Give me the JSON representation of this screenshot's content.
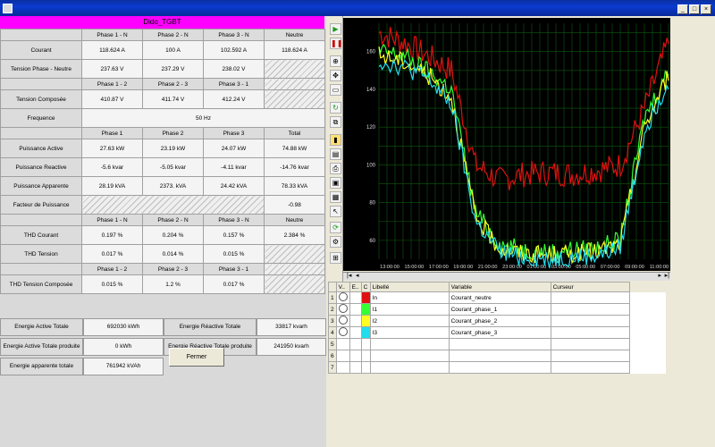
{
  "window": {
    "title_buttons": [
      "_",
      "□",
      "×"
    ]
  },
  "banner": "Dido_TGBT",
  "table": {
    "rows": [
      {
        "type": "hdr",
        "cells": [
          "Phase 1 - N",
          "Phase 2 - N",
          "Phase 3 - N",
          "Neutre"
        ]
      },
      {
        "type": "data",
        "label": "Courant",
        "cells": [
          "118.624 A",
          "100 A",
          "102.592 A",
          "118.624 A"
        ]
      },
      {
        "type": "data",
        "label": "Tension Phase - Neutre",
        "cells": [
          "237.63 V",
          "237.29 V",
          "238.02 V"
        ]
      },
      {
        "type": "hdr",
        "cells": [
          "Phase 1 - 2",
          "Phase 2 - 3",
          "Phase 3 - 1"
        ]
      },
      {
        "type": "data",
        "label": "Tension Composée",
        "cells": [
          "410.87 V",
          "411.74 V",
          "412.24 V"
        ]
      },
      {
        "type": "data",
        "label": "Frequence",
        "span": "50 Hz"
      },
      {
        "type": "hdr",
        "cells": [
          "Phase 1",
          "Phase 2",
          "Phase 3",
          "Total"
        ]
      },
      {
        "type": "data",
        "label": "Puissance Active",
        "cells": [
          "27.63 kW",
          "23.19 kW",
          "24.07 kW",
          "74.88 kW"
        ]
      },
      {
        "type": "data",
        "label": "Puissance Reactive",
        "cells": [
          "-5.6 kvar",
          "-5.05 kvar",
          "-4.11 kvar",
          "-14.76 kvar"
        ]
      },
      {
        "type": "data",
        "label": "Puissance Apparente",
        "cells": [
          "28.19 kVA",
          "2373. kVA",
          "24.42 kVA",
          "78.33 kVA"
        ]
      },
      {
        "type": "data",
        "label": "Facteur de Puissance",
        "hatched3": true,
        "cells": [
          "-0.98"
        ]
      },
      {
        "type": "hdr",
        "cells": [
          "Phase 1 - N",
          "Phase 2 - N",
          "Phase 3 - N",
          "Neutre"
        ]
      },
      {
        "type": "data",
        "label": "THD Courant",
        "cells": [
          "0.197 %",
          "0.204 %",
          "0.157 %",
          "2.384 %"
        ]
      },
      {
        "type": "data",
        "label": "THD Tension",
        "cells": [
          "0.017 %",
          "0.014 %",
          "0.015 %"
        ]
      },
      {
        "type": "hdr",
        "cells": [
          "Phase 1 - 2",
          "Phase 2 - 3",
          "Phase 3 - 1"
        ]
      },
      {
        "type": "data",
        "label": "THD Tension Composée",
        "cells": [
          "0.015 %",
          "1.2 %",
          "0.017 %"
        ]
      }
    ]
  },
  "energy": [
    {
      "label": "Energie Active Totale consommée",
      "value": "692030 kWh"
    },
    {
      "label": "Energie Réactive Totale consommée",
      "value": "33817 kvarh"
    },
    {
      "label": "Energie Active Totale produite",
      "value": "0 kWh"
    },
    {
      "label": "Energie Réactive Totale produite",
      "value": "241950 kvarh"
    },
    {
      "label": "Energie apparente totale",
      "value": "761942 kVAh"
    }
  ],
  "fermer_label": "Fermer",
  "chart_data": {
    "type": "line",
    "x": [
      "13:00:00",
      "15:00:00",
      "17:00:00",
      "19:00:00",
      "21:00:00",
      "23:00:00",
      "01:00:00",
      "03:00:00",
      "05:00:00",
      "07:00:00",
      "09:00:00",
      "11:00:00"
    ],
    "yticks": [
      60,
      80,
      100,
      120,
      140,
      160
    ],
    "ylim": [
      50,
      175
    ],
    "series": [
      {
        "name": "In",
        "color": "#e01010",
        "values": [
          170,
          165,
          158,
          150,
          100,
          92,
          95,
          96,
          95,
          97,
          100,
          130,
          165
        ]
      },
      {
        "name": "I1",
        "color": "#33ff33",
        "values": [
          160,
          158,
          150,
          140,
          75,
          58,
          55,
          54,
          55,
          56,
          60,
          125,
          150
        ]
      },
      {
        "name": "I2",
        "color": "#ffff22",
        "values": [
          158,
          155,
          148,
          136,
          72,
          56,
          53,
          52,
          53,
          54,
          58,
          120,
          148
        ]
      },
      {
        "name": "I3",
        "color": "#22ddee",
        "values": [
          155,
          152,
          146,
          132,
          70,
          54,
          51,
          50,
          51,
          52,
          56,
          118,
          145
        ]
      }
    ]
  },
  "var_table": {
    "headers": [
      "",
      "V..",
      "E..",
      "C",
      "Libellé",
      "Variable",
      "Curseur"
    ],
    "rows": [
      {
        "n": "1",
        "libelle": "In",
        "variable": "Courant_neutre",
        "color": "#e01010"
      },
      {
        "n": "2",
        "libelle": "I1",
        "variable": "Courant_phase_1",
        "color": "#33ff33"
      },
      {
        "n": "3",
        "libelle": "I2",
        "variable": "Courant_phase_2",
        "color": "#ffff22"
      },
      {
        "n": "4",
        "libelle": "I3",
        "variable": "Courant_phase_3",
        "color": "#22ddee"
      },
      {
        "n": "5"
      },
      {
        "n": "6"
      },
      {
        "n": "7"
      }
    ]
  },
  "toolbar_icons": [
    "play-icon",
    "pause-icon",
    "zoom-icon",
    "pan-icon",
    "select-icon",
    "refresh-icon",
    "cursor-icon",
    "grid-icon"
  ]
}
